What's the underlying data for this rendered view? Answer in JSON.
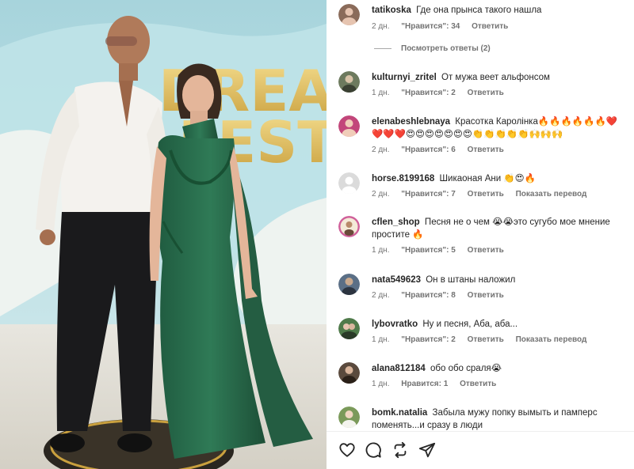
{
  "post": {
    "photo_sign": "DREAM FEST"
  },
  "comments": [
    {
      "user": "tatikoska",
      "text": "Где она прынса такого нашла",
      "time": "2 дн.",
      "likes": "\"Нравится\": 34",
      "reply": "Ответить",
      "translate": "",
      "avatar_color": "#8a6b5a"
    },
    {
      "user": "kulturnyi_zritel",
      "text": "От мужа веет альфонсом",
      "time": "1 дн.",
      "likes": "\"Нравится\": 2",
      "reply": "Ответить",
      "translate": "",
      "avatar_color": "#6d7a5e"
    },
    {
      "user": "elenabeshlebnaya",
      "text": "Красотка Каролінка🔥🔥🔥🔥🔥🔥❤️❤️❤️❤️😍😍😍😍😍😍😍👏👏👏👏👏🙌🙌🙌",
      "time": "2 дн.",
      "likes": "\"Нравится\": 6",
      "reply": "Ответить",
      "translate": "",
      "avatar_color": "#c2467a"
    },
    {
      "user": "horse.8199168",
      "text": "Шикаоная Ани 👏😍🔥",
      "time": "2 дн.",
      "likes": "\"Нравится\": 7",
      "reply": "Ответить",
      "translate": "Показать перевод",
      "avatar_color": "#c7c7c7"
    },
    {
      "user": "cflen_shop",
      "text": "Песня не о чем 😭😭это сугубо мое мнение простите 🔥",
      "time": "1 дн.",
      "likes": "\"Нравится\": 5",
      "reply": "Ответить",
      "translate": "",
      "avatar_color": "#d0609a"
    },
    {
      "user": "nata549623",
      "text": "Он в штаны наложил",
      "time": "2 дн.",
      "likes": "\"Нравится\": 8",
      "reply": "Ответить",
      "translate": "",
      "avatar_color": "#5b6f86"
    },
    {
      "user": "lybovratko",
      "text": "Ну и песня, Аба, аба...",
      "time": "1 дн.",
      "likes": "\"Нравится\": 2",
      "reply": "Ответить",
      "translate": "Показать перевод",
      "avatar_color": "#4f7a4a"
    },
    {
      "user": "alana812184",
      "text": "обо обо сраля😭",
      "time": "1 дн.",
      "likes": "Нравится: 1",
      "reply": "Ответить",
      "translate": "",
      "avatar_color": "#5a4a3d"
    },
    {
      "user": "bomk.natalia",
      "text": "Забыла мужу попку вымыть и памперс поменять...и сразу в люди",
      "time": "",
      "likes": "",
      "reply": "",
      "translate": "",
      "avatar_color": "#7b9a5a"
    }
  ],
  "view_replies": "Посмотреть ответы (2)",
  "actions": {
    "like": "heart-icon",
    "comment": "comment-icon",
    "repost": "repost-icon",
    "share": "share-icon"
  }
}
